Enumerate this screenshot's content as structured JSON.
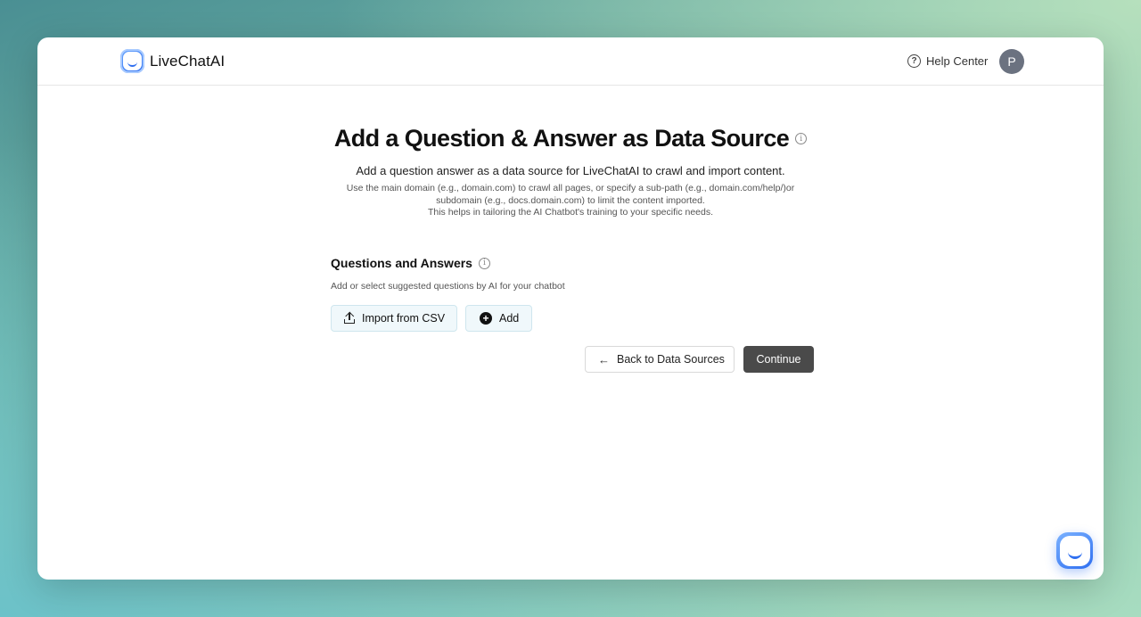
{
  "app": {
    "brand": "LiveChatAI",
    "help_label": "Help Center",
    "avatar_initial": "P"
  },
  "hero": {
    "title": "Add a Question & Answer as Data Source",
    "subtitle": "Add a question answer as a data source for LiveChatAI to crawl and import content.",
    "desc_line1": "Use the main domain (e.g., domain.com) to crawl all pages, or specify a sub-path (e.g., domain.com/help/)or",
    "desc_line2": "subdomain (e.g., docs.domain.com) to limit the content imported.",
    "desc_line3": "This helps in tailoring the AI Chatbot's training to your specific needs."
  },
  "qa": {
    "title": "Questions and Answers",
    "subtitle": "Add or select suggested questions by AI for your chatbot",
    "import_label": "Import from CSV",
    "add_label": "Add"
  },
  "footer": {
    "back_label": "Back to Data Sources",
    "continue_label": "Continue"
  },
  "icons": {
    "help": "question-circle-icon",
    "info": "info-circle-icon",
    "upload": "upload-icon",
    "plus": "plus-circle-icon",
    "back": "arrow-left-icon",
    "chat": "chat-widget-icon"
  },
  "colors": {
    "accent": "#2f6ff0",
    "primary_button": "#4a4a4a",
    "light_button_bg": "#f0f8fb"
  }
}
